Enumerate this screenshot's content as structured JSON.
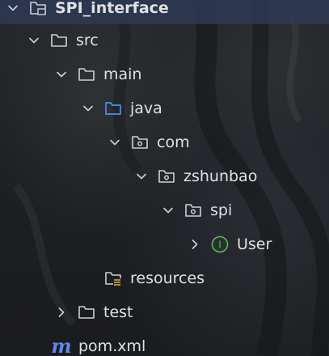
{
  "tree": {
    "items": [
      {
        "label": "SPI_interface",
        "icon": "module-folder-icon",
        "expanded": true
      },
      {
        "label": "src",
        "icon": "folder-icon",
        "expanded": true
      },
      {
        "label": "main",
        "icon": "folder-icon",
        "expanded": true
      },
      {
        "label": "java",
        "icon": "source-root-folder-icon",
        "expanded": true
      },
      {
        "label": "com",
        "icon": "package-icon",
        "expanded": true
      },
      {
        "label": "zshunbao",
        "icon": "package-icon",
        "expanded": true
      },
      {
        "label": "spi",
        "icon": "package-icon",
        "expanded": true
      },
      {
        "label": "User",
        "icon": "interface-icon",
        "expanded": false,
        "icon_letter": "I"
      },
      {
        "label": "resources",
        "icon": "resources-folder-icon"
      },
      {
        "label": "test",
        "icon": "folder-icon",
        "expanded": false
      },
      {
        "label": "pom.xml",
        "icon": "maven-icon",
        "icon_letter": "m"
      }
    ]
  },
  "colors": {
    "text": "#dfe1e5",
    "icon_stroke": "#ced0d6",
    "source_root_blue": "#548af7",
    "interface_green": "#5fb865",
    "maven_blue": "#5f87e8",
    "resources_yellow": "#d9a343",
    "selection": "#2e3b56"
  }
}
